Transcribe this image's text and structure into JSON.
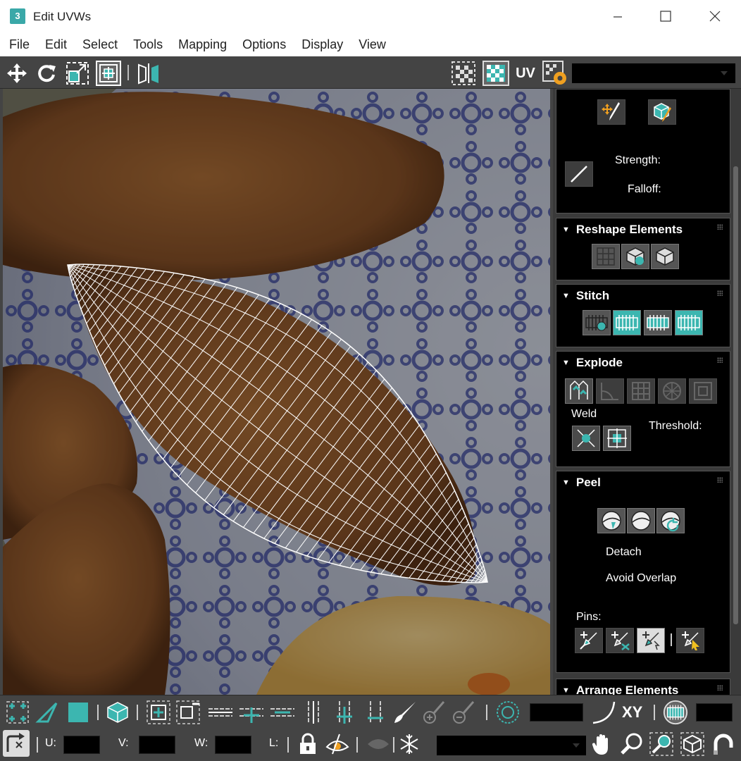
{
  "window": {
    "title": "Edit UVWs",
    "app_icon_glyph": "3",
    "controls": [
      "minimize-icon",
      "maximize-icon",
      "close-icon"
    ]
  },
  "menu": [
    "File",
    "Edit",
    "Select",
    "Tools",
    "Mapping",
    "Options",
    "Display",
    "View"
  ],
  "top_toolbar": {
    "uv_label": "UV",
    "tools": [
      "move-icon",
      "rotate-icon",
      "scale-icon",
      "freeform-icon",
      "mirror-icon",
      "checker-pattern-icon",
      "checker-map-icon",
      "uv-toggle",
      "map-settings-icon"
    ],
    "map_dropdown_value": ""
  },
  "panel": {
    "brush": {
      "strength_label": "Strength:",
      "falloff_label": "Falloff:"
    },
    "reshape": {
      "title": "Reshape Elements"
    },
    "stitch": {
      "title": "Stitch"
    },
    "explode": {
      "title": "Explode",
      "weld_label": "Weld",
      "threshold_label": "Threshold:"
    },
    "peel": {
      "title": "Peel",
      "detach_label": "Detach",
      "avoid_overlap_label": "Avoid Overlap",
      "pins_label": "Pins:"
    },
    "arrange": {
      "title": "Arrange Elements"
    }
  },
  "bottom_bar": {
    "xy_label": "XY",
    "u_label": "U:",
    "v_label": "V:",
    "w_label": "W:",
    "l_label": "L:",
    "u_value": "",
    "v_value": "",
    "w_value": "",
    "l_value": ""
  },
  "colors": {
    "accent_teal": "#3cb6b0",
    "toolbar_bg": "#444444",
    "panel_bg": "#000000",
    "wireframe": "#ffffff"
  }
}
